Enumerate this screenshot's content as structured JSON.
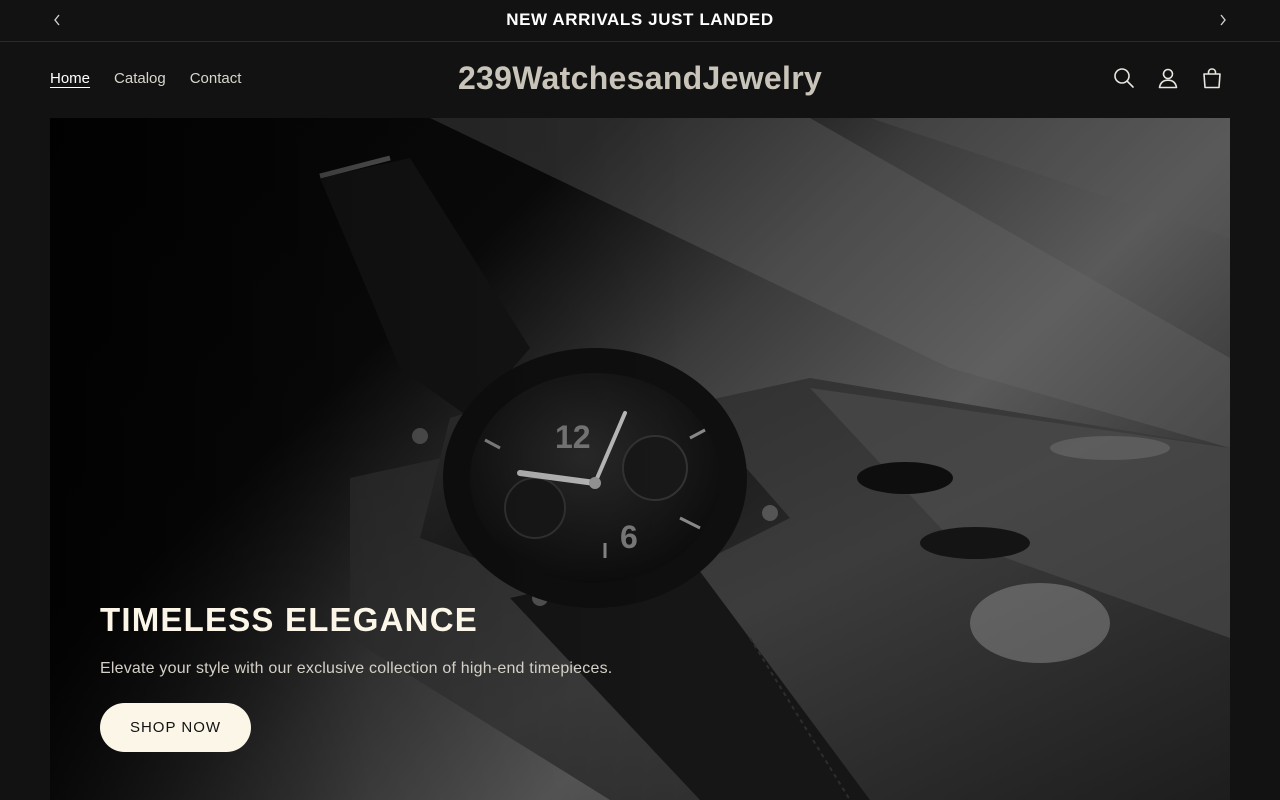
{
  "announcement": {
    "message": "NEW ARRIVALS JUST LANDED",
    "prev_icon": "chevron-left-icon",
    "next_icon": "chevron-right-icon"
  },
  "header": {
    "nav": [
      {
        "label": "Home",
        "active": true
      },
      {
        "label": "Catalog",
        "active": false
      },
      {
        "label": "Contact",
        "active": false
      }
    ],
    "logo_text": "239WatchesandJewelry",
    "icons": [
      "search-icon",
      "account-icon",
      "cart-icon"
    ]
  },
  "hero": {
    "title": "TIMELESS ELEGANCE",
    "subtitle": "Elevate your style with our exclusive collection of high-end timepieces.",
    "cta_label": "SHOP NOW",
    "image_subject": "black-watch-on-stone"
  },
  "colors": {
    "background": "#121212",
    "button_bg": "#fbf6e8",
    "title_text": "#fbf6e8",
    "logo_text": "#c9c4b9"
  }
}
